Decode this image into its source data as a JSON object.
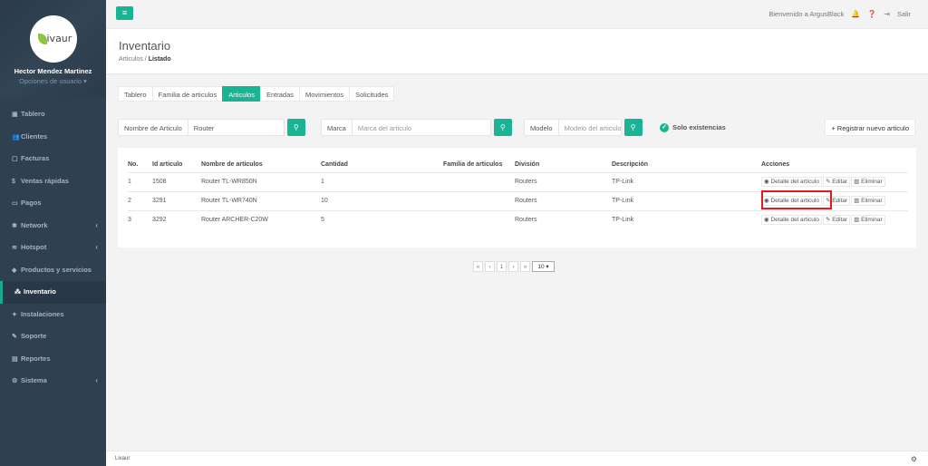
{
  "sidebar": {
    "logo_text": "ivaur",
    "user_name": "Hector Mendez Martinez",
    "user_options": "Opciones de usuario ▾",
    "items": [
      {
        "label": "Tablero",
        "icon": "dashboard-icon",
        "glyph": "▣",
        "chev": ""
      },
      {
        "label": "Clientes",
        "icon": "users-icon",
        "glyph": "👥",
        "chev": ""
      },
      {
        "label": "Facturas",
        "icon": "file-icon",
        "glyph": "▢",
        "chev": ""
      },
      {
        "label": "Ventas rápidas",
        "icon": "dollar-icon",
        "glyph": "$",
        "chev": ""
      },
      {
        "label": "Pagos",
        "icon": "money-icon",
        "glyph": "▭",
        "chev": ""
      },
      {
        "label": "Network",
        "icon": "sitemap-icon",
        "glyph": "✱",
        "chev": "‹"
      },
      {
        "label": "Hotspot",
        "icon": "wifi-icon",
        "glyph": "≋",
        "chev": "‹"
      },
      {
        "label": "Productos y servicios",
        "icon": "tag-icon",
        "glyph": "◆",
        "chev": ""
      },
      {
        "label": "Inventario",
        "icon": "cubes-icon",
        "glyph": "⁂",
        "chev": ""
      },
      {
        "label": "Instalaciones",
        "icon": "tools-icon",
        "glyph": "✦",
        "chev": ""
      },
      {
        "label": "Soporte",
        "icon": "wrench-icon",
        "glyph": "✎",
        "chev": ""
      },
      {
        "label": "Reportes",
        "icon": "book-icon",
        "glyph": "▤",
        "chev": ""
      },
      {
        "label": "Sistema",
        "icon": "cogs-icon",
        "glyph": "⚙",
        "chev": "‹"
      }
    ],
    "active_index": 8
  },
  "topbar": {
    "menu_glyph": "≡",
    "welcome": "Bienvenido a ArgusBlack",
    "logout": "Salir"
  },
  "heading": {
    "title": "Inventario",
    "crumb1": "Articulos",
    "crumb_sep": "/",
    "crumb2": "Listado"
  },
  "tabs": [
    "Tablero",
    "Familia de articulos",
    "Articulos",
    "Entradas",
    "Movimientos",
    "Solicitudes"
  ],
  "active_tab": 2,
  "filters": {
    "name_label": "Nombre de Articulo",
    "name_value": "Router",
    "brand_label": "Marca",
    "brand_placeholder": "Marca del articulo",
    "model_label": "Modelo",
    "model_placeholder": "Modelo del articulo",
    "stock_label": "Solo existencias",
    "register_label": "+ Registrar nuevo articulo"
  },
  "table": {
    "headers": [
      "No.",
      "Id articulo",
      "Nombre de articulos",
      "Cantidad",
      "Familia de articulos",
      "División",
      "Descripción",
      "Acciones"
    ],
    "rows": [
      {
        "no": "1",
        "id": "1508",
        "name": "Router TL-WR850N",
        "qty": "1",
        "family": "",
        "division": "Routers",
        "desc": "TP-Link"
      },
      {
        "no": "2",
        "id": "3291",
        "name": "Router TL-WR740N",
        "qty": "10",
        "family": "",
        "division": "Routers",
        "desc": "TP-Link"
      },
      {
        "no": "3",
        "id": "3292",
        "name": "Router ARCHER-C20W",
        "qty": "5",
        "family": "",
        "division": "Routers",
        "desc": "TP-Link"
      }
    ],
    "actions": {
      "detail": "◉ Detalle del articulo",
      "edit": "✎ Editar",
      "delete": "▥ Eliminar"
    }
  },
  "pagination": {
    "first": "«",
    "prev": "‹",
    "page": "1",
    "next": "›",
    "last": "»",
    "per_page": "10 ▾"
  },
  "footer": {
    "text": "Livaur"
  },
  "colors": {
    "accent": "#1ab394",
    "sidebar": "#2f4050",
    "highlight": "#e01c1c"
  }
}
